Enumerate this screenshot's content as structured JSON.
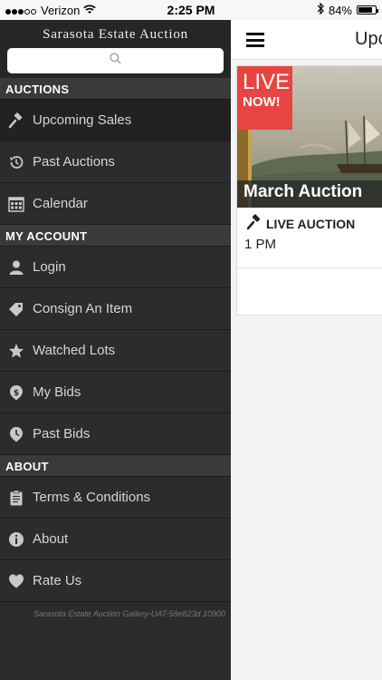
{
  "status_bar": {
    "carrier": "Verizon",
    "time": "2:25 PM",
    "battery": "84%",
    "battery_level": 0.84
  },
  "sidebar": {
    "title": "Sarasota Estate Auction",
    "search_icon": "search-icon",
    "sections": [
      {
        "title": "AUCTIONS",
        "items": [
          {
            "label": "Upcoming Sales",
            "icon": "gavel-icon",
            "active": true
          },
          {
            "label": "Past Auctions",
            "icon": "history-icon"
          },
          {
            "label": "Calendar",
            "icon": "calendar-icon"
          }
        ]
      },
      {
        "title": "MY ACCOUNT",
        "items": [
          {
            "label": "Login",
            "icon": "user-icon"
          },
          {
            "label": "Consign An Item",
            "icon": "tag-icon"
          },
          {
            "label": "Watched Lots",
            "icon": "star-icon"
          },
          {
            "label": "My Bids",
            "icon": "dollar-icon"
          },
          {
            "label": "Past Bids",
            "icon": "clock-icon"
          }
        ]
      },
      {
        "title": "ABOUT",
        "items": [
          {
            "label": "Terms & Conditions",
            "icon": "clipboard-icon"
          },
          {
            "label": "About",
            "icon": "info-icon"
          },
          {
            "label": "Rate Us",
            "icon": "heart-icon"
          }
        ]
      }
    ],
    "footer": "Sarasota Estate Auction Gallery-UAT-58e823d 10900"
  },
  "main": {
    "title": "Upc",
    "card": {
      "badge_line1": "LIVE",
      "badge_line2": "NOW!",
      "caption": "March Auction",
      "type": "LIVE AUCTION",
      "time": "1 PM"
    }
  },
  "colors": {
    "sidebar_bg": "#2b2b2b",
    "live_badge": "#e64541"
  }
}
